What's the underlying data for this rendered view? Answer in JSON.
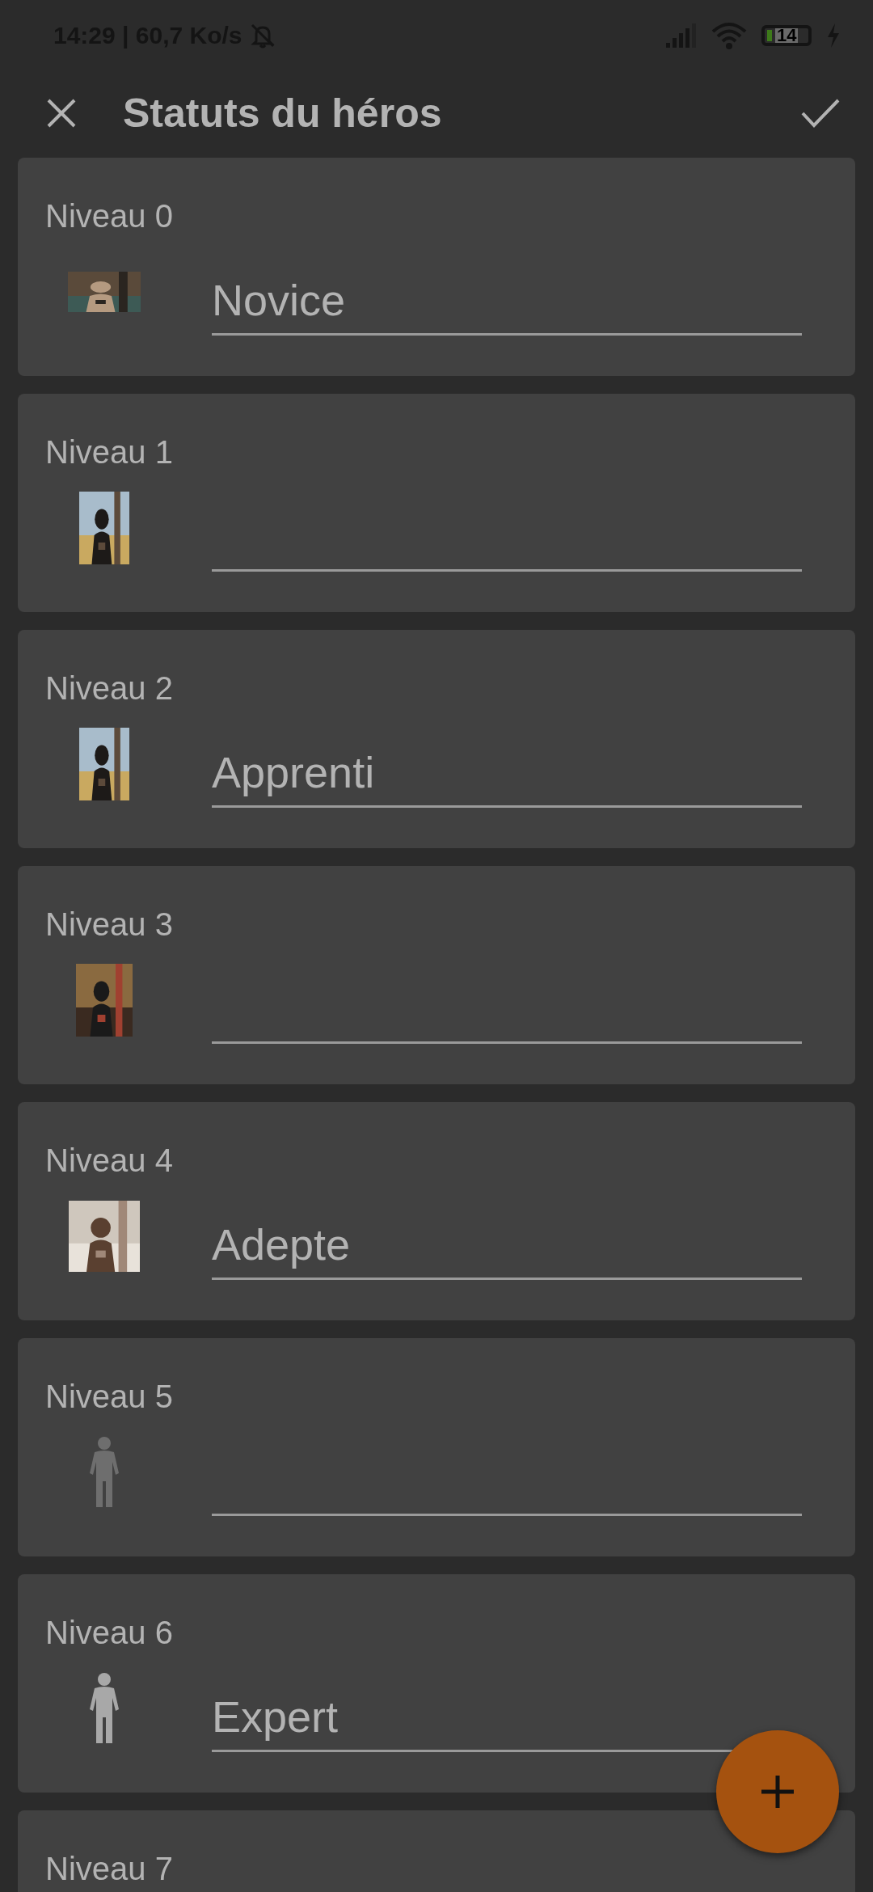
{
  "status_bar": {
    "text": "14:29 | 60,7 Ko/s",
    "battery": "14"
  },
  "app_bar": {
    "title": "Statuts du héros"
  },
  "levels": [
    {
      "label": "Niveau 0",
      "value": "Novice"
    },
    {
      "label": "Niveau 1"
    },
    {
      "label": "Niveau 2",
      "value": "Apprenti"
    },
    {
      "label": "Niveau 3"
    },
    {
      "label": "Niveau 4",
      "value": "Adepte"
    },
    {
      "label": "Niveau 5",
      "image": {
        "kind": "figure",
        "dimmed": true
      }
    },
    {
      "label": "Niveau 6",
      "image": {
        "kind": "figure",
        "dimmed": false
      },
      "value": "Expert"
    },
    {
      "label": "Niveau 7"
    }
  ]
}
